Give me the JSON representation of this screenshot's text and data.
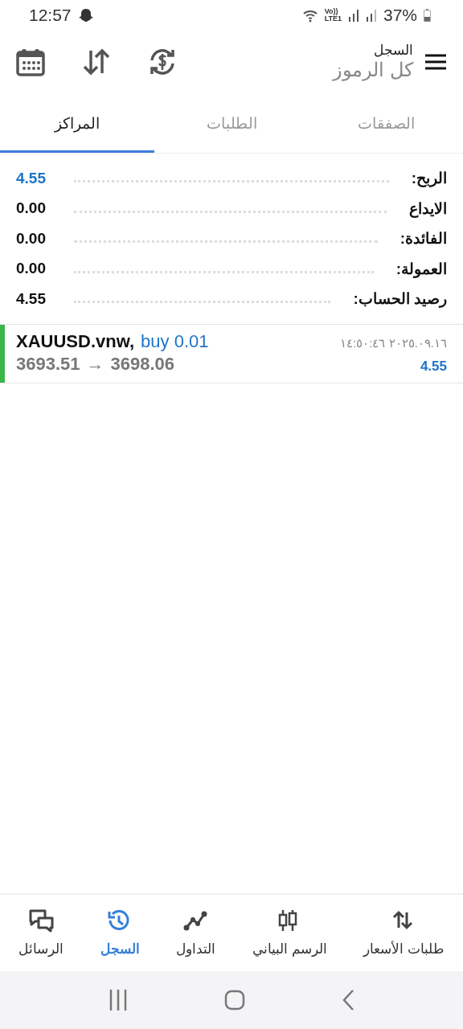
{
  "status_bar": {
    "time": "12:57",
    "volte": "Vo))",
    "network": "LTE1",
    "battery": "37%"
  },
  "header": {
    "subtitle": "السجل",
    "title": "كل الرموز"
  },
  "tabs": [
    {
      "label": "الصفقات",
      "selected": false
    },
    {
      "label": "الطلبات",
      "selected": false
    },
    {
      "label": "المراكز",
      "selected": true
    }
  ],
  "summary": [
    {
      "label": "الربح:",
      "value": "4.55",
      "color": "#1e73c8"
    },
    {
      "label": "الايداع",
      "value": "0.00",
      "color": "#111111"
    },
    {
      "label": "الفائدة:",
      "value": "0.00",
      "color": "#111111"
    },
    {
      "label": "العمولة:",
      "value": "0.00",
      "color": "#111111"
    },
    {
      "label": "رصيد الحساب:",
      "value": "4.55",
      "color": "#111111"
    }
  ],
  "positions": [
    {
      "symbol": "XAUUSD.vnw,",
      "side": "buy 0.01",
      "open_price": "3693.51",
      "arrow": "→",
      "close_price": "3698.06",
      "time": "٢٠٢٥.٠٩.١٦ ١٤:٥٠:٤٦",
      "profit": "4.55",
      "color": "#3cb54a"
    }
  ],
  "bottom_nav": [
    {
      "label": "طلبات الأسعار",
      "kind": "quotes",
      "selected": false
    },
    {
      "label": "الرسم البياني",
      "kind": "chart",
      "selected": false
    },
    {
      "label": "التداول",
      "kind": "trade",
      "selected": false
    },
    {
      "label": "السجل",
      "kind": "history",
      "selected": true
    },
    {
      "label": "الرسائل",
      "kind": "messages",
      "selected": false
    }
  ]
}
